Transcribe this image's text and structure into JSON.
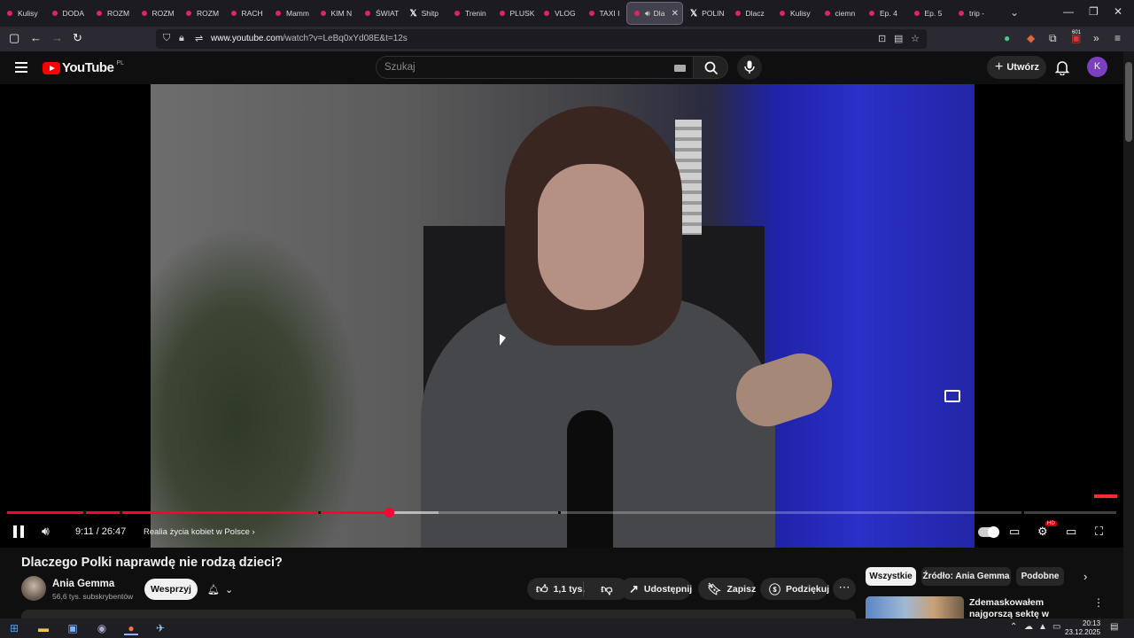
{
  "browser": {
    "tabs": [
      {
        "label": "Kulisy",
        "kind": "dot"
      },
      {
        "label": "DODA",
        "kind": "dot"
      },
      {
        "label": "ROZM",
        "kind": "dot"
      },
      {
        "label": "ROZM",
        "kind": "dot"
      },
      {
        "label": "ROZM",
        "kind": "dot"
      },
      {
        "label": "RACH",
        "kind": "dot"
      },
      {
        "label": "Mamm",
        "kind": "dot"
      },
      {
        "label": "KIM N",
        "kind": "dot"
      },
      {
        "label": "ŚWIAT",
        "kind": "dot"
      },
      {
        "label": "Shitp",
        "kind": "x"
      },
      {
        "label": "Trenin",
        "kind": "dot"
      },
      {
        "label": "PLUSK",
        "kind": "dot"
      },
      {
        "label": "VLOG",
        "kind": "dot"
      },
      {
        "label": "TAXI I",
        "kind": "dot"
      },
      {
        "label": "Dla",
        "kind": "active"
      },
      {
        "label": "POLIN",
        "kind": "x"
      },
      {
        "label": "Dlacz",
        "kind": "dot"
      },
      {
        "label": "Kulisy",
        "kind": "dot"
      },
      {
        "label": "ciemn",
        "kind": "dot"
      },
      {
        "label": "Ep. 4",
        "kind": "dot"
      },
      {
        "label": "Ep. 5",
        "kind": "dot"
      },
      {
        "label": "trip - ",
        "kind": "dot"
      }
    ],
    "url_host": "www.youtube.com",
    "url_path": "/watch?v=LeBq0xYd08E&t=12s",
    "extension_badge": "601"
  },
  "youtube": {
    "logo_text": "YouTube",
    "country_code": "PL",
    "search_placeholder": "Szukaj",
    "create_label": "Utwórz",
    "avatar_letter": "K"
  },
  "player": {
    "current_time": "9:11",
    "duration": "26:47",
    "time_display": "9:11 / 26:47",
    "chapter_title": "Realia życia kobiet w Polsce",
    "played_fraction": 0.344,
    "loaded_fraction": 0.389
  },
  "video": {
    "title": "Dlaczego Polki naprawdę nie rodzą dzieci?",
    "channel": "Ania Gemma",
    "subscribers": "56,6 tys. subskrybentów",
    "support_label": "Wesprzyj",
    "likes": "1,1 tys.",
    "share_label": "Udostępnij",
    "save_label": "Zapisz",
    "thanks_label": "Podziękuj"
  },
  "sidebar": {
    "chips": [
      "Wszystkie",
      "Źródło: Ania Gemma",
      "Podobne"
    ],
    "recommendation_title": "Zdemaskowałem najgorszą sektę w Ameryce"
  },
  "taskbar": {
    "time": "20:13",
    "date": "23.12.2025"
  },
  "colors": {
    "accent_red": "#ff0033",
    "brand_red": "#ff0000",
    "background": "#0f0f0f"
  }
}
